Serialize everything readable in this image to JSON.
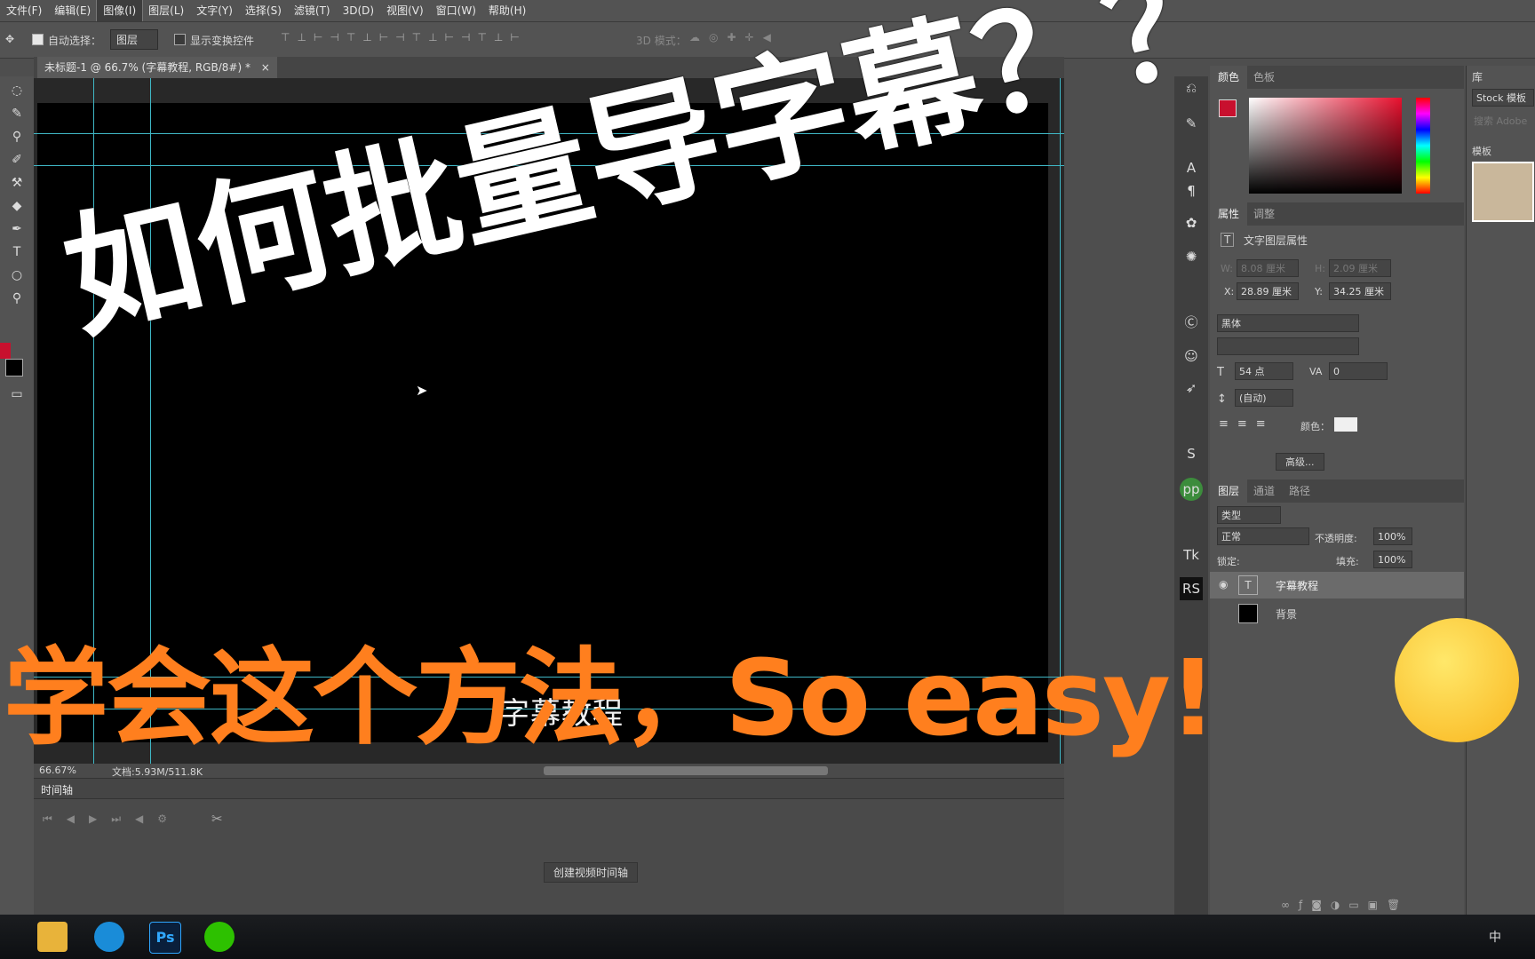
{
  "menu": [
    "文件(F)",
    "编辑(E)",
    "图像(I)",
    "图层(L)",
    "文字(Y)",
    "选择(S)",
    "滤镜(T)",
    "3D(D)",
    "视图(V)",
    "窗口(W)",
    "帮助(H)"
  ],
  "menu_active": "图像(I)",
  "options": {
    "auto_select_label": "自动选择：",
    "auto_select_value": "图层",
    "show_transform_label": "显示变换控件",
    "mode_3d_label": "3D 模式："
  },
  "document": {
    "tab_title": "未标题-1 @ 66.7% (字幕教程, RGB/8#) *",
    "canvas_text": "字幕教程"
  },
  "status": {
    "zoom": "66.67%",
    "doc_size": "文档:5.93M/511.8K"
  },
  "timeline": {
    "title": "时间轴",
    "create_button": "创建视频时间轴"
  },
  "color_panel": {
    "tabs": [
      "颜色",
      "色板"
    ],
    "foreground": "#c8102e",
    "background": "#000000"
  },
  "properties_panel": {
    "tabs": [
      "属性",
      "调整"
    ],
    "header": "文字图层属性",
    "w_label": "W:",
    "w_value": "8.08 厘米",
    "h_label": "H:",
    "h_value": "2.09 厘米",
    "x_label": "X:",
    "x_value": "28.89 厘米",
    "y_label": "Y:",
    "y_value": "34.25 厘米",
    "font_family": "黑体",
    "font_size": "54 点",
    "tracking": "0",
    "leading": "(自动)",
    "color_label": "颜色：",
    "advanced_button": "高级..."
  },
  "layers_panel": {
    "tabs": [
      "图层",
      "通道",
      "路径"
    ],
    "filter_label": "类型",
    "blend_mode": "正常",
    "opacity_label": "不透明度:",
    "opacity_value": "100%",
    "lock_label": "锁定:",
    "fill_label": "填充:",
    "fill_value": "100%",
    "layers": [
      "字幕教程",
      "背景"
    ]
  },
  "library_panel": {
    "title": "库",
    "stock_label": "Stock 模板",
    "search_placeholder": "搜索 Adobe",
    "templates_label": "模板"
  },
  "overlay": {
    "headline": "如何批量导字幕？？",
    "subline": "学会这个方法，So easy!",
    "headline_color": "#ffffff",
    "subline_color": "#ff7f1e"
  },
  "taskbar": {
    "ime": "中",
    "apps": [
      "file-explorer",
      "browser",
      "photoshop",
      "wechat"
    ],
    "ps_label": "Ps"
  }
}
